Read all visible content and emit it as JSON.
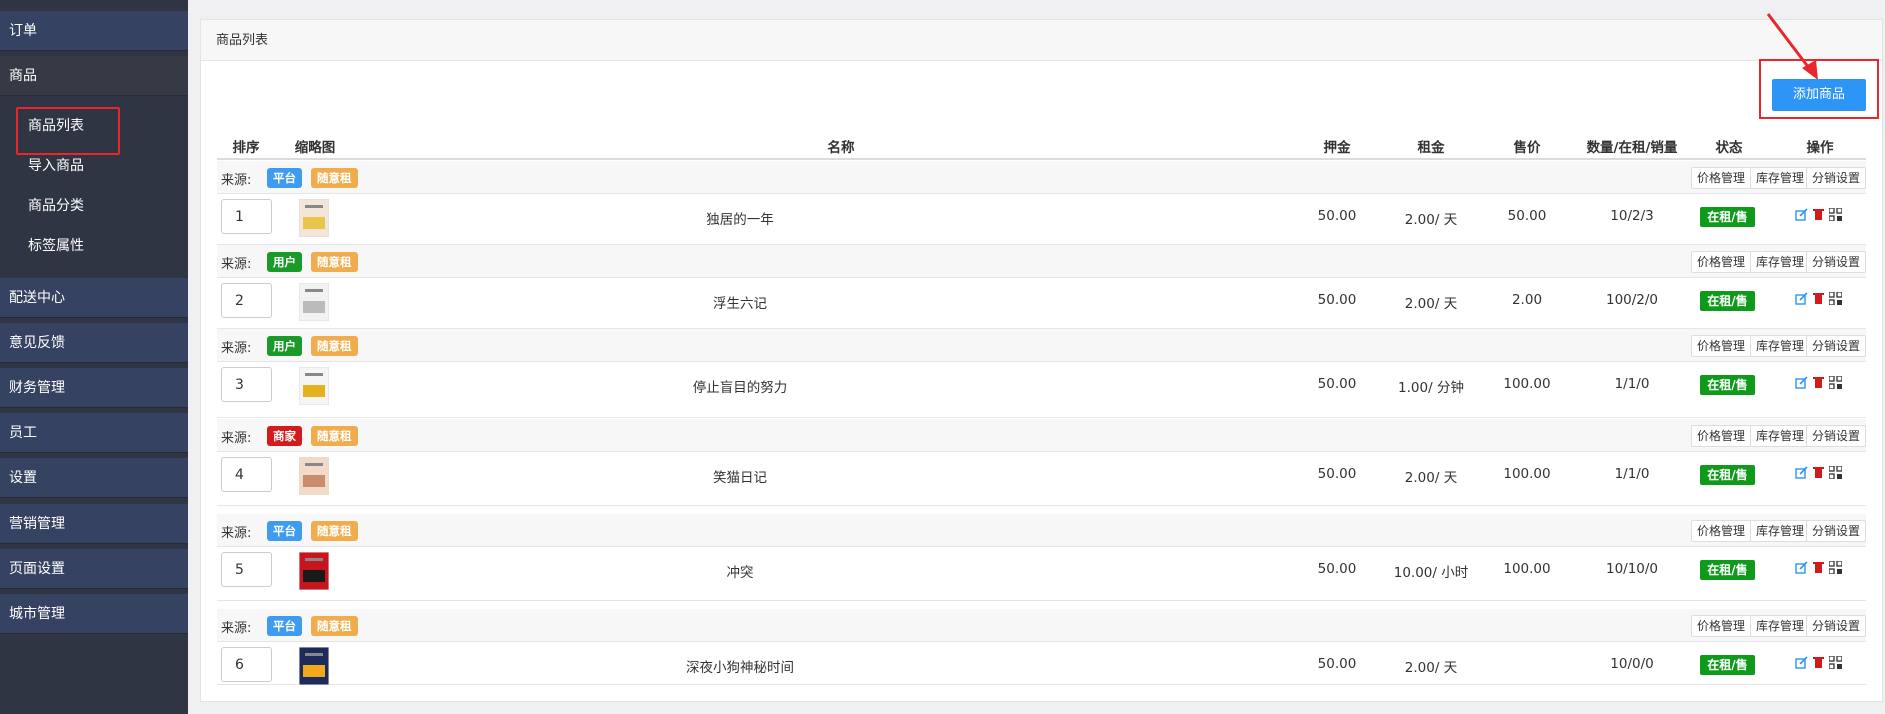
{
  "sidebar": {
    "top": {
      "label": "订单"
    },
    "product": {
      "label": "商品"
    },
    "sub": [
      {
        "label": "商品列表"
      },
      {
        "label": "导入商品"
      },
      {
        "label": "商品分类"
      },
      {
        "label": "标签属性"
      }
    ],
    "items": [
      {
        "label": "配送中心"
      },
      {
        "label": "意见反馈"
      },
      {
        "label": "财务管理"
      },
      {
        "label": "员工"
      },
      {
        "label": "设置"
      },
      {
        "label": "营销管理"
      },
      {
        "label": "页面设置"
      },
      {
        "label": "城市管理"
      }
    ]
  },
  "panel": {
    "title": "商品列表",
    "add_label": "添加商品"
  },
  "table": {
    "headers": {
      "sort": "排序",
      "thumb": "缩略图",
      "name": "名称",
      "deposit": "押金",
      "rent": "租金",
      "price": "售价",
      "qty": "数量/在租/销量",
      "status": "状态",
      "ops": "操作"
    },
    "source_label": "来源:",
    "mode_tag": "随意租",
    "btn_price": "价格管理",
    "btn_stock": "库存管理",
    "btn_dist": "分销设置",
    "rows": [
      {
        "sort": "1",
        "source": "平台",
        "source_color": "#3e9bf0",
        "name": "独居的一年",
        "deposit": "50.00",
        "rent": "2.00/ 天",
        "price": "50.00",
        "qty": "10/2/3",
        "status": "在租/售",
        "thumb_colors": [
          "#f3e6d8",
          "#e8c64a"
        ]
      },
      {
        "sort": "2",
        "source": "用户",
        "source_color": "#1a9a28",
        "name": "浮生六记",
        "deposit": "50.00",
        "rent": "2.00/ 天",
        "price": "2.00",
        "qty": "100/2/0",
        "status": "在租/售",
        "thumb_colors": [
          "#f2f2f2",
          "#bbbbbb"
        ]
      },
      {
        "sort": "3",
        "source": "用户",
        "source_color": "#1a9a28",
        "name": "停止盲目的努力",
        "deposit": "50.00",
        "rent": "1.00/ 分钟",
        "price": "100.00",
        "qty": "1/1/0",
        "status": "在租/售",
        "thumb_colors": [
          "#f5f5f5",
          "#e3b21d"
        ]
      },
      {
        "sort": "4",
        "source": "商家",
        "source_color": "#d31b1b",
        "name": "笑猫日记",
        "deposit": "50.00",
        "rent": "2.00/ 天",
        "price": "100.00",
        "qty": "1/1/0",
        "status": "在租/售",
        "thumb_colors": [
          "#f3d9c8",
          "#c98d6e"
        ]
      },
      {
        "sort": "5",
        "source": "平台",
        "source_color": "#3e9bf0",
        "name": "冲突",
        "deposit": "50.00",
        "rent": "10.00/ 小时",
        "price": "100.00",
        "qty": "10/10/0",
        "status": "在租/售",
        "thumb_colors": [
          "#c8141c",
          "#1a1a1a"
        ]
      },
      {
        "sort": "6",
        "source": "平台",
        "source_color": "#3e9bf0",
        "name": "深夜小狗神秘时间",
        "deposit": "50.00",
        "rent": "2.00/ 天",
        "price": "",
        "qty": "10/0/0",
        "status": "在租/售",
        "thumb_colors": [
          "#1d2a5c",
          "#f0a91c"
        ]
      }
    ]
  },
  "colors": {
    "accent": "#2d95f5",
    "highlight": "#e8262b",
    "status": "#109a1c",
    "sidebar": "#2f3542"
  }
}
